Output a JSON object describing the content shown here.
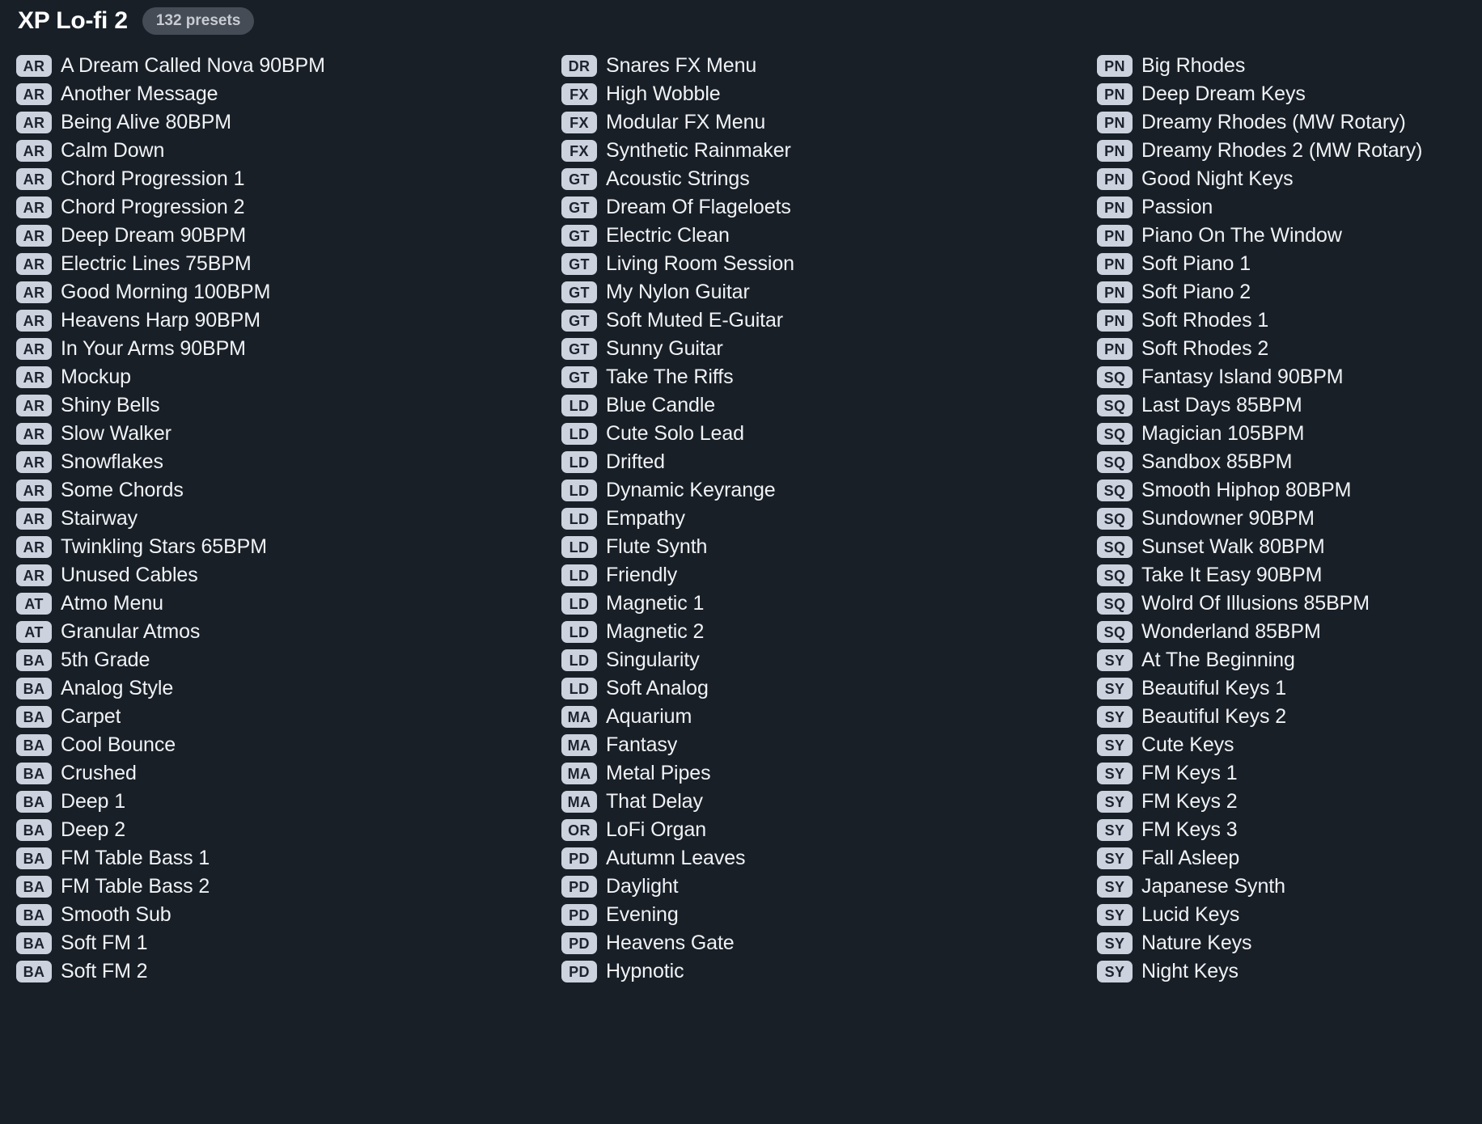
{
  "header": {
    "title": "XP Lo-fi 2",
    "preset_count_label": "132 presets"
  },
  "colors": {
    "background": "#181f27",
    "badge_background": "#ccd2de",
    "badge_text": "#1d2430",
    "preset_text": "#f0f2f5",
    "pill_background": "#454c56",
    "pill_text": "#c8ccd2"
  },
  "columns": [
    {
      "name": "column-1",
      "presets": [
        {
          "category": "AR",
          "name": "A Dream Called Nova 90BPM"
        },
        {
          "category": "AR",
          "name": "Another Message"
        },
        {
          "category": "AR",
          "name": "Being Alive 80BPM"
        },
        {
          "category": "AR",
          "name": "Calm Down"
        },
        {
          "category": "AR",
          "name": "Chord Progression 1"
        },
        {
          "category": "AR",
          "name": "Chord Progression 2"
        },
        {
          "category": "AR",
          "name": "Deep Dream 90BPM"
        },
        {
          "category": "AR",
          "name": "Electric Lines 75BPM"
        },
        {
          "category": "AR",
          "name": "Good Morning 100BPM"
        },
        {
          "category": "AR",
          "name": "Heavens Harp 90BPM"
        },
        {
          "category": "AR",
          "name": "In Your Arms 90BPM"
        },
        {
          "category": "AR",
          "name": "Mockup"
        },
        {
          "category": "AR",
          "name": "Shiny Bells"
        },
        {
          "category": "AR",
          "name": "Slow Walker"
        },
        {
          "category": "AR",
          "name": "Snowflakes"
        },
        {
          "category": "AR",
          "name": "Some Chords"
        },
        {
          "category": "AR",
          "name": "Stairway"
        },
        {
          "category": "AR",
          "name": "Twinkling Stars 65BPM"
        },
        {
          "category": "AR",
          "name": "Unused Cables"
        },
        {
          "category": "AT",
          "name": "Atmo Menu"
        },
        {
          "category": "AT",
          "name": "Granular Atmos"
        },
        {
          "category": "BA",
          "name": "5th Grade"
        },
        {
          "category": "BA",
          "name": "Analog Style"
        },
        {
          "category": "BA",
          "name": "Carpet"
        },
        {
          "category": "BA",
          "name": "Cool Bounce"
        },
        {
          "category": "BA",
          "name": "Crushed"
        },
        {
          "category": "BA",
          "name": "Deep 1"
        },
        {
          "category": "BA",
          "name": "Deep 2"
        },
        {
          "category": "BA",
          "name": "FM Table Bass 1"
        },
        {
          "category": "BA",
          "name": "FM Table Bass 2"
        },
        {
          "category": "BA",
          "name": "Smooth Sub"
        },
        {
          "category": "BA",
          "name": "Soft FM 1"
        },
        {
          "category": "BA",
          "name": "Soft FM 2"
        }
      ]
    },
    {
      "name": "column-2",
      "presets": [
        {
          "category": "DR",
          "name": "Snares FX Menu"
        },
        {
          "category": "FX",
          "name": "High Wobble"
        },
        {
          "category": "FX",
          "name": "Modular FX Menu"
        },
        {
          "category": "FX",
          "name": "Synthetic Rainmaker"
        },
        {
          "category": "GT",
          "name": "Acoustic Strings"
        },
        {
          "category": "GT",
          "name": "Dream Of Flageloets"
        },
        {
          "category": "GT",
          "name": "Electric Clean"
        },
        {
          "category": "GT",
          "name": "Living Room Session"
        },
        {
          "category": "GT",
          "name": "My Nylon Guitar"
        },
        {
          "category": "GT",
          "name": "Soft Muted E-Guitar"
        },
        {
          "category": "GT",
          "name": "Sunny Guitar"
        },
        {
          "category": "GT",
          "name": "Take The Riffs"
        },
        {
          "category": "LD",
          "name": "Blue Candle"
        },
        {
          "category": "LD",
          "name": "Cute Solo Lead"
        },
        {
          "category": "LD",
          "name": "Drifted"
        },
        {
          "category": "LD",
          "name": "Dynamic Keyrange"
        },
        {
          "category": "LD",
          "name": "Empathy"
        },
        {
          "category": "LD",
          "name": "Flute Synth"
        },
        {
          "category": "LD",
          "name": "Friendly"
        },
        {
          "category": "LD",
          "name": "Magnetic 1"
        },
        {
          "category": "LD",
          "name": "Magnetic 2"
        },
        {
          "category": "LD",
          "name": "Singularity"
        },
        {
          "category": "LD",
          "name": "Soft Analog"
        },
        {
          "category": "MA",
          "name": "Aquarium"
        },
        {
          "category": "MA",
          "name": "Fantasy"
        },
        {
          "category": "MA",
          "name": "Metal Pipes"
        },
        {
          "category": "MA",
          "name": "That Delay"
        },
        {
          "category": "OR",
          "name": "LoFi Organ"
        },
        {
          "category": "PD",
          "name": "Autumn Leaves"
        },
        {
          "category": "PD",
          "name": "Daylight"
        },
        {
          "category": "PD",
          "name": "Evening"
        },
        {
          "category": "PD",
          "name": "Heavens Gate"
        },
        {
          "category": "PD",
          "name": "Hypnotic"
        }
      ]
    },
    {
      "name": "column-3",
      "presets": [
        {
          "category": "PN",
          "name": "Big Rhodes"
        },
        {
          "category": "PN",
          "name": "Deep Dream Keys"
        },
        {
          "category": "PN",
          "name": "Dreamy Rhodes (MW Rotary)"
        },
        {
          "category": "PN",
          "name": "Dreamy Rhodes 2 (MW Rotary)"
        },
        {
          "category": "PN",
          "name": "Good Night Keys"
        },
        {
          "category": "PN",
          "name": "Passion"
        },
        {
          "category": "PN",
          "name": "Piano On The Window"
        },
        {
          "category": "PN",
          "name": "Soft Piano 1"
        },
        {
          "category": "PN",
          "name": "Soft Piano 2"
        },
        {
          "category": "PN",
          "name": "Soft Rhodes 1"
        },
        {
          "category": "PN",
          "name": "Soft Rhodes 2"
        },
        {
          "category": "SQ",
          "name": "Fantasy Island 90BPM"
        },
        {
          "category": "SQ",
          "name": "Last Days 85BPM"
        },
        {
          "category": "SQ",
          "name": "Magician 105BPM"
        },
        {
          "category": "SQ",
          "name": "Sandbox 85BPM"
        },
        {
          "category": "SQ",
          "name": "Smooth Hiphop 80BPM"
        },
        {
          "category": "SQ",
          "name": "Sundowner 90BPM"
        },
        {
          "category": "SQ",
          "name": "Sunset Walk 80BPM"
        },
        {
          "category": "SQ",
          "name": "Take It Easy 90BPM"
        },
        {
          "category": "SQ",
          "name": "Wolrd Of Illusions 85BPM"
        },
        {
          "category": "SQ",
          "name": "Wonderland 85BPM"
        },
        {
          "category": "SY",
          "name": "At The Beginning"
        },
        {
          "category": "SY",
          "name": "Beautiful Keys 1"
        },
        {
          "category": "SY",
          "name": "Beautiful Keys 2"
        },
        {
          "category": "SY",
          "name": "Cute Keys"
        },
        {
          "category": "SY",
          "name": "FM Keys 1"
        },
        {
          "category": "SY",
          "name": "FM Keys 2"
        },
        {
          "category": "SY",
          "name": "FM Keys 3"
        },
        {
          "category": "SY",
          "name": "Fall Asleep"
        },
        {
          "category": "SY",
          "name": "Japanese Synth"
        },
        {
          "category": "SY",
          "name": "Lucid Keys"
        },
        {
          "category": "SY",
          "name": "Nature Keys"
        },
        {
          "category": "SY",
          "name": "Night Keys"
        }
      ]
    }
  ]
}
